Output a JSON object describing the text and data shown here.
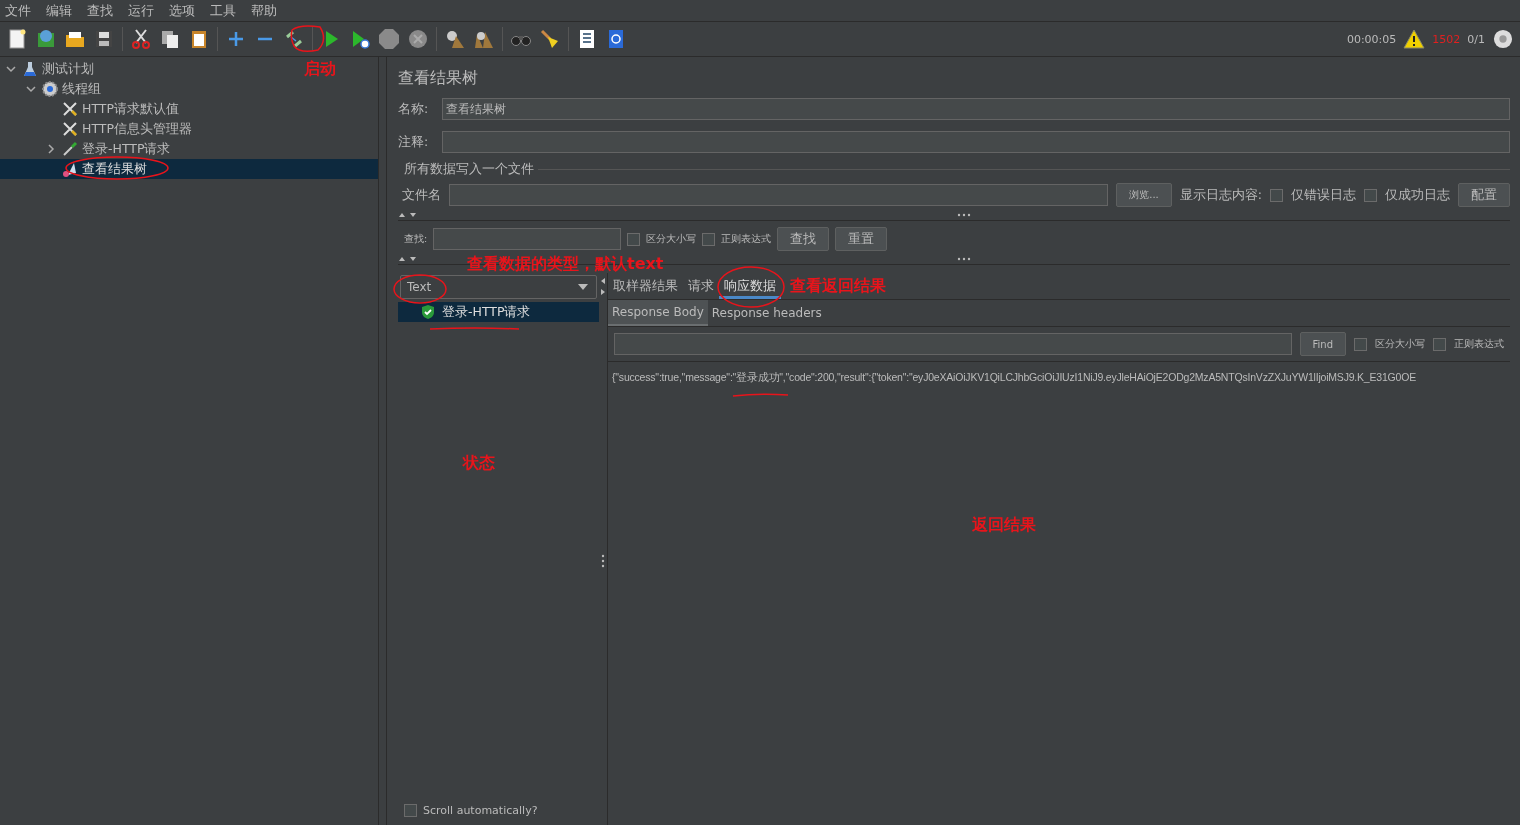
{
  "menu": [
    "文件",
    "编辑",
    "查找",
    "运行",
    "选项",
    "工具",
    "帮助"
  ],
  "status": {
    "elapsed": "00:00:05",
    "error_count": "1502",
    "threads": "0/1"
  },
  "tree": [
    {
      "label": "测试计划",
      "kind": "plan",
      "expanded": true,
      "selected": false,
      "children": [
        {
          "label": "线程组",
          "kind": "thread-group",
          "expanded": true,
          "selected": false,
          "children": [
            {
              "label": "HTTP请求默认值",
              "kind": "config",
              "selected": false
            },
            {
              "label": "HTTP信息头管理器",
              "kind": "config",
              "selected": false
            },
            {
              "label": "登录-HTTP请求",
              "kind": "sampler",
              "expanded": false,
              "selected": false
            },
            {
              "label": "查看结果树",
              "kind": "listener",
              "selected": true
            }
          ]
        }
      ]
    }
  ],
  "panel": {
    "title": "查看结果树",
    "name_label": "名称:",
    "name_value": "查看结果树",
    "comment_label": "注释:",
    "file_section": "所有数据写入一个文件",
    "file_label": "文件名",
    "browse_button": "浏览...",
    "log_label": "显示日志内容:",
    "log_options": [
      {
        "label": "仅错误日志",
        "checked": false
      },
      {
        "label": "仅成功日志",
        "checked": false
      }
    ],
    "config_button": "配置"
  },
  "search": {
    "label": "查找:",
    "options": [
      {
        "label": "区分大小写",
        "checked": false
      },
      {
        "label": "正则表达式",
        "checked": false
      }
    ],
    "find_button": "查找",
    "reset_button": "重置"
  },
  "results": {
    "renderer": "Text",
    "items": [
      {
        "label": "登录-HTTP请求",
        "success": true,
        "selected": true
      }
    ],
    "scroll_auto": {
      "label": "Scroll automatically?",
      "checked": false
    }
  },
  "tabs": [
    {
      "label": "取样器结果",
      "selected": false
    },
    {
      "label": "请求",
      "selected": false
    },
    {
      "label": "响应数据",
      "selected": true
    }
  ],
  "subtabs": [
    {
      "label": "Response Body",
      "selected": true
    },
    {
      "label": "Response headers",
      "selected": false
    }
  ],
  "response_search": {
    "find_button": "Find",
    "options": [
      {
        "label": "区分大小写",
        "checked": false
      },
      {
        "label": "正则表达式",
        "checked": false
      }
    ]
  },
  "response_text": "{\"success\":true,\"message\":\"登录成功\",\"code\":200,\"result\":{\"token\":\"eyJ0eXAiOiJKV1QiLCJhbGciOiJIUzI1NiJ9.eyJleHAiOjE2ODg2MzA5NTQsInVzZXJuYW1lIjoiMSJ9.K_E31G0OE",
  "annotations": [
    "启动",
    "查看数据的类型，默认text",
    "查看返回结果",
    "状态",
    "返回结果"
  ]
}
